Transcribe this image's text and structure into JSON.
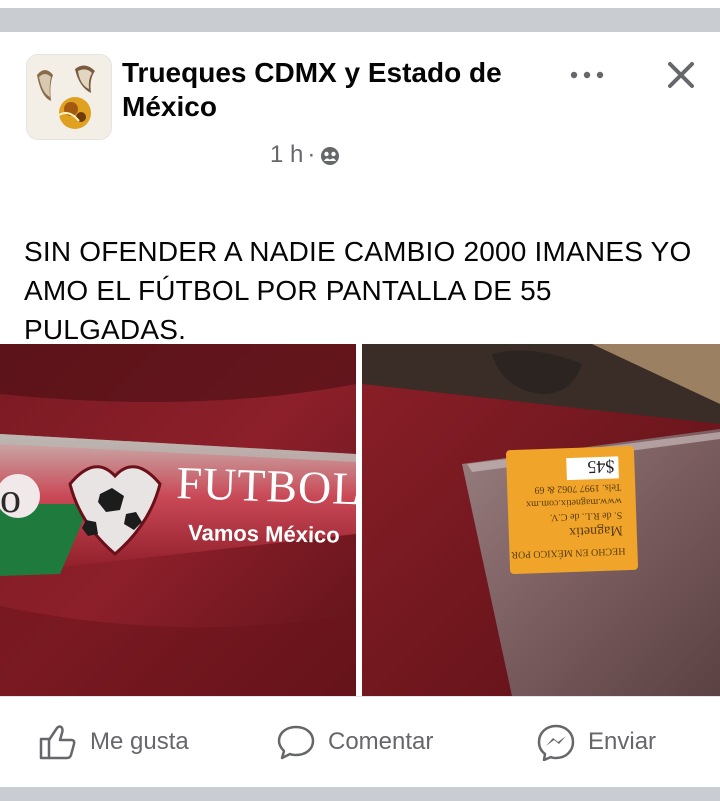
{
  "post": {
    "group_name": "Trueques CDMX y Estado de México",
    "time": "1 h",
    "separator": "·",
    "audience_icon": "group-audience-icon",
    "body": "SIN OFENDER A NADIE CAMBIO 2000 IMANES YO AMO EL FÚTBOL POR PANTALLA DE 55 PULGADAS."
  },
  "photos": {
    "left": {
      "banner_word": "FUTBOL",
      "banner_partial_left": "o",
      "banner_slogan": "Vamos México"
    },
    "right": {
      "price_tag": "$45",
      "tag_lines": [
        "Magnetix",
        "S. de R.L. de C.V.",
        "www.magnetix.com.mx",
        "Tels. 1997 7062 & 69",
        "HECHO EN MÉXICO POR"
      ]
    }
  },
  "actions": {
    "like": "Me gusta",
    "comment": "Comentar",
    "share": "Enviar"
  },
  "colors": {
    "text_primary": "#050505",
    "text_secondary": "#65676b",
    "separator_bar": "#c9ccd1"
  }
}
